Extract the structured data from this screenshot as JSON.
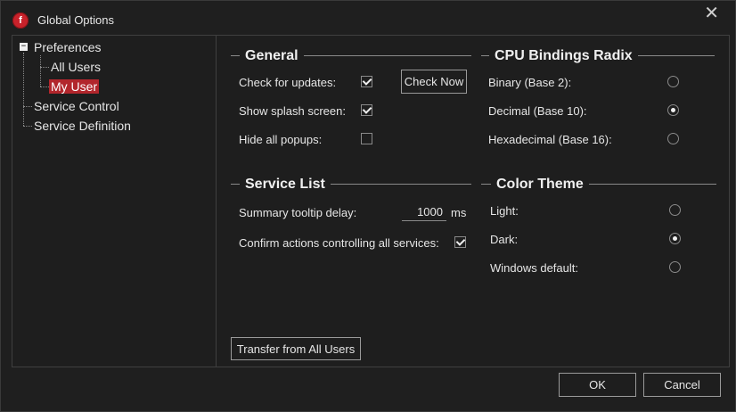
{
  "window": {
    "title": "Global Options",
    "close_glyph": "✕",
    "app_icon_letter": "f"
  },
  "tree": {
    "preferences": "Preferences",
    "all_users": "All Users",
    "my_user": "My User",
    "service_control": "Service Control",
    "service_definition": "Service Definition",
    "collapse_glyph": "−"
  },
  "general": {
    "header": "General",
    "check_updates_label": "Check for updates:",
    "check_updates": true,
    "check_now_button": "Check Now",
    "splash_label": "Show splash screen:",
    "splash": true,
    "hide_popups_label": "Hide all popups:",
    "hide_popups": false
  },
  "cpu_radix": {
    "header": "CPU Bindings Radix",
    "options": [
      "Binary (Base 2):",
      "Decimal (Base 10):",
      "Hexadecimal (Base 16):"
    ],
    "selected": "Decimal (Base 10):"
  },
  "service_list": {
    "header": "Service List",
    "tooltip_delay_label": "Summary tooltip delay:",
    "tooltip_delay_value": "1000",
    "tooltip_delay_unit": "ms",
    "confirm_label": "Confirm actions controlling all services:",
    "confirm": true
  },
  "color_theme": {
    "header": "Color Theme",
    "options": [
      "Light:",
      "Dark:",
      "Windows default:"
    ],
    "selected": "Dark:"
  },
  "transfer_button": "Transfer from All Users",
  "footer": {
    "ok": "OK",
    "cancel": "Cancel"
  },
  "colors": {
    "accent": "#b2262c",
    "background": "#1f1f1f",
    "border": "#3f3f3f"
  }
}
